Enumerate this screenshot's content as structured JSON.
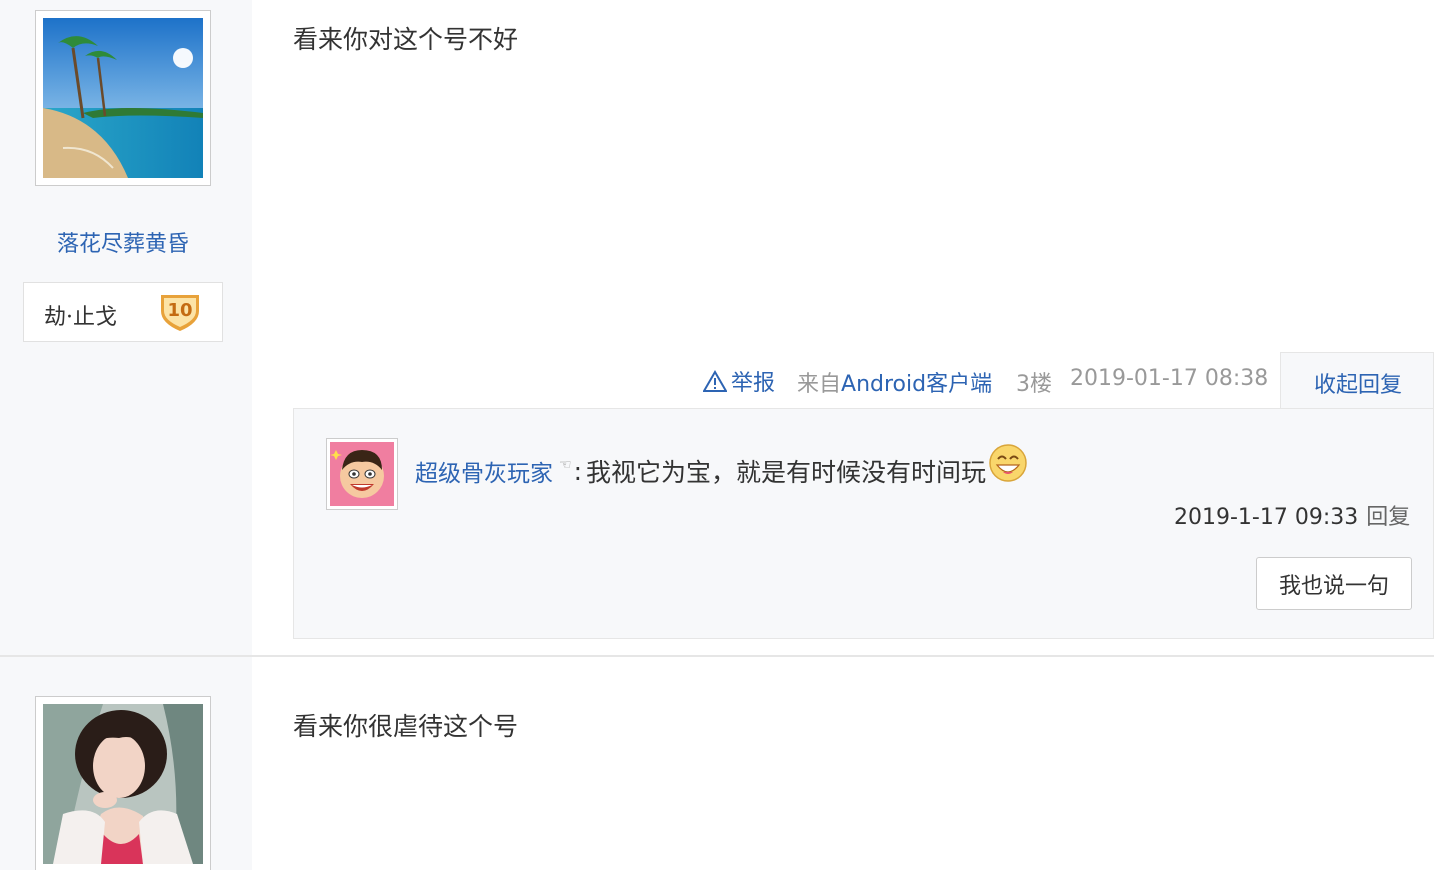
{
  "posts": [
    {
      "author": {
        "name": "落花尽葬黄昏",
        "level_name": "劫·止戈",
        "level": "10"
      },
      "content": "看来你对这个号不好",
      "tail": {
        "report": "举报",
        "from_prefix": "来自",
        "client": "Android客户端",
        "floor": "3楼",
        "time": "2019-01-17 08:38",
        "collapse": "收起回复"
      },
      "replies": [
        {
          "user": "超级骨灰玩家",
          "hand": "☜",
          "separator": ":",
          "message": "我视它为宝，就是有时候没有时间玩",
          "time": "2019-1-17 09:33",
          "reply_label": "回复"
        }
      ],
      "say_button": "我也说一句"
    },
    {
      "content": "看来你很虐待这个号"
    }
  ],
  "colors": {
    "link": "#2d64b3",
    "sidebar_bg": "#f7f8fa",
    "meta_gray": "#999999",
    "badge_gold": "#e8a23a"
  }
}
